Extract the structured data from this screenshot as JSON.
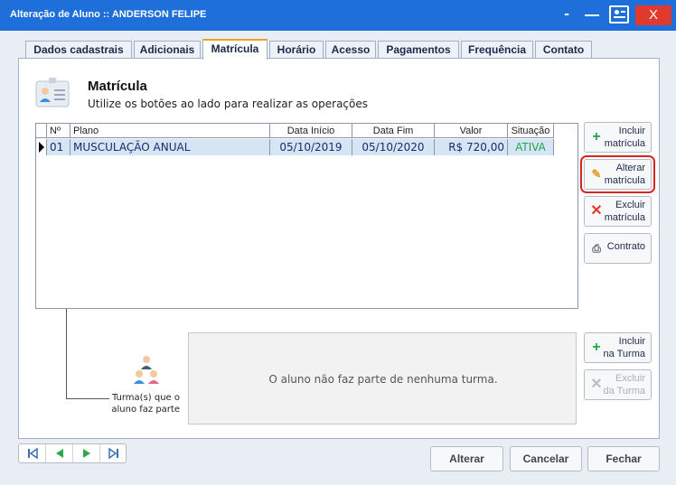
{
  "window": {
    "title": "Alteração de Aluno :: ANDERSON FELIPE",
    "close_label": "X"
  },
  "tabs": [
    {
      "label": "Dados cadastrais"
    },
    {
      "label": "Adicionais"
    },
    {
      "label": "Matrícula",
      "active": true
    },
    {
      "label": "Horário"
    },
    {
      "label": "Acesso"
    },
    {
      "label": "Pagamentos"
    },
    {
      "label": "Frequência"
    },
    {
      "label": "Contato"
    }
  ],
  "header": {
    "title": "Matrícula",
    "subtitle": "Utilize os botões ao lado para realizar as operações"
  },
  "grid": {
    "columns": [
      "Nº",
      "Plano",
      "Data Início",
      "Data Fim",
      "Valor",
      "Situação"
    ],
    "rows": [
      {
        "num": "01",
        "plano": "MUSCULAÇÃO ANUAL",
        "inicio": "05/10/2019",
        "fim": "05/10/2020",
        "valor": "R$ 720,00",
        "situacao": "ATIVA"
      }
    ]
  },
  "actions": {
    "incluir": [
      "Incluir",
      "matrícula"
    ],
    "alterar": [
      "Alterar",
      "matrícula"
    ],
    "excluir": [
      "Excluir",
      "matrícula"
    ],
    "contrato": "Contrato",
    "incluir_turma": [
      "Incluir",
      "na Turma"
    ],
    "excluir_turma": [
      "Excluir",
      "da Turma"
    ]
  },
  "turma": {
    "label_line1": "Turma(s) que o",
    "label_line2": "aluno faz parte",
    "empty_message": "O aluno não faz parte de nenhuma turma."
  },
  "footer": {
    "alterar": "Alterar",
    "cancelar": "Cancelar",
    "fechar": "Fechar"
  },
  "colors": {
    "titlebar": "#1e6fd9",
    "active_status": "#20a84a",
    "highlight": "#d9261c",
    "selected_row": "#d6e5f5"
  }
}
